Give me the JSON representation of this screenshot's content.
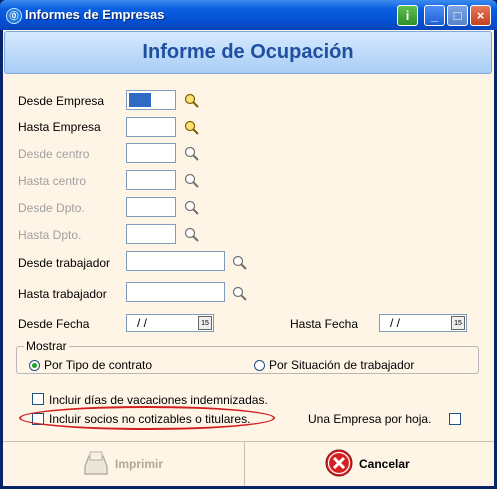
{
  "window": {
    "title": "Informes de Empresas"
  },
  "header": {
    "title": "Informe de Ocupación"
  },
  "filters": {
    "desde_empresa": "Desde Empresa",
    "hasta_empresa": "Hasta Empresa",
    "desde_centro": "Desde centro",
    "hasta_centro": "Hasta centro",
    "desde_dpto": "Desde Dpto.",
    "hasta_dpto": "Hasta Dpto.",
    "desde_trabajador": "Desde trabajador",
    "hasta_trabajador": "Hasta trabajador",
    "desde_fecha": "Desde Fecha",
    "hasta_fecha": "Hasta Fecha",
    "desde_fecha_value": "/ /",
    "hasta_fecha_value": "/ /"
  },
  "mostrar": {
    "legend": "Mostrar",
    "option1": "Por Tipo de contrato",
    "option2": "Por Situación de trabajador",
    "selected": "option1"
  },
  "options": {
    "vacaciones": "Incluir días de vacaciones indemnizadas.",
    "socios": "Incluir socios no cotizables o titulares.",
    "una_empresa": "Una Empresa por hoja."
  },
  "buttons": {
    "imprimir": "Imprimir",
    "cancelar": "Cancelar"
  },
  "colors": {
    "titlebar": "#0550d4",
    "client_bg": "#fff5e6",
    "header_text": "#1f4f9f",
    "highlight": "#d02020"
  }
}
